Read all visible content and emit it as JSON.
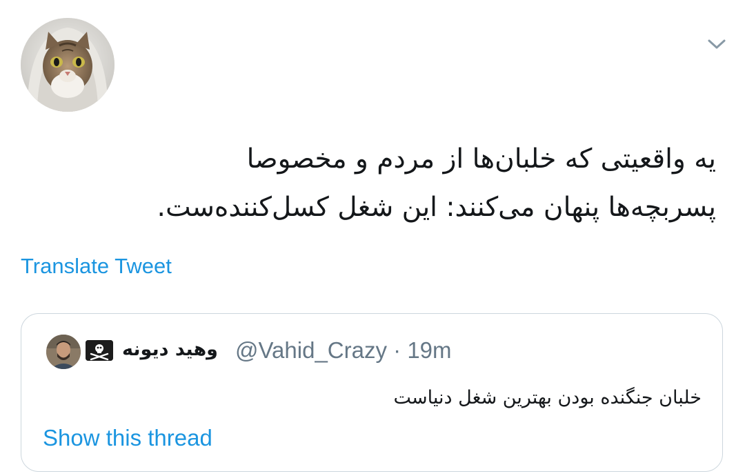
{
  "tweet": {
    "text_line1": "یه واقعیتی که خلبان‌ها از مردم و مخصوصا",
    "text_line2": "پسربچه‌ها پنهان می‌کنند: این شغل کسل‌کننده‌ست.",
    "translate_label": "Translate Tweet"
  },
  "quoted_tweet": {
    "display_name": "وهید دیونه",
    "handle": "@Vahid_Crazy",
    "separator": "·",
    "time": "19m",
    "text": "خلبان جنگنده بودن بهترین شغل دنیاست",
    "show_thread_label": "Show this thread"
  },
  "icons": {
    "menu": "chevron-down-icon",
    "badge": "skull-crossbones-icon"
  },
  "colors": {
    "link": "#1b95e0",
    "secondary_text": "#657786",
    "border": "#ccd6dd",
    "chevron": "#8899a6"
  }
}
